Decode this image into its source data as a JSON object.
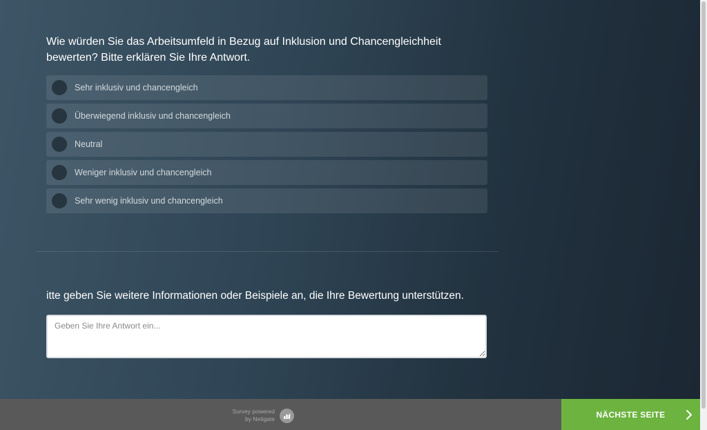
{
  "question1": {
    "title": "Wie würden Sie das Arbeitsumfeld in Bezug auf Inklusion und Chancengleichheit bewerten? Bitte erklären Sie Ihre Antwort.",
    "options": [
      {
        "label": "Sehr inklusiv und chancengleich"
      },
      {
        "label": "Überwiegend inklusiv und chancengleich"
      },
      {
        "label": "Neutral"
      },
      {
        "label": "Weniger inklusiv und chancengleich"
      },
      {
        "label": "Sehr wenig inklusiv und chancengleich"
      }
    ]
  },
  "question2": {
    "title": "itte geben Sie weitere Informationen oder Beispiele an, die Ihre Bewertung unterstützen.",
    "placeholder": "Geben Sie Ihre Antwort ein...",
    "value": ""
  },
  "footer": {
    "powered_line1": "Survey powered",
    "powered_line2": "by Netigate",
    "logo_icon": "netigate-logo-icon",
    "next_label": "NÄCHSTE SEITE",
    "next_icon": "chevron-right-icon"
  },
  "colors": {
    "background_start": "#3d5566",
    "background_end": "#1b2733",
    "option_bg": "rgba(255,255,255,0.09)",
    "footer_bg": "#595959",
    "next_button": "#6cb33f"
  }
}
